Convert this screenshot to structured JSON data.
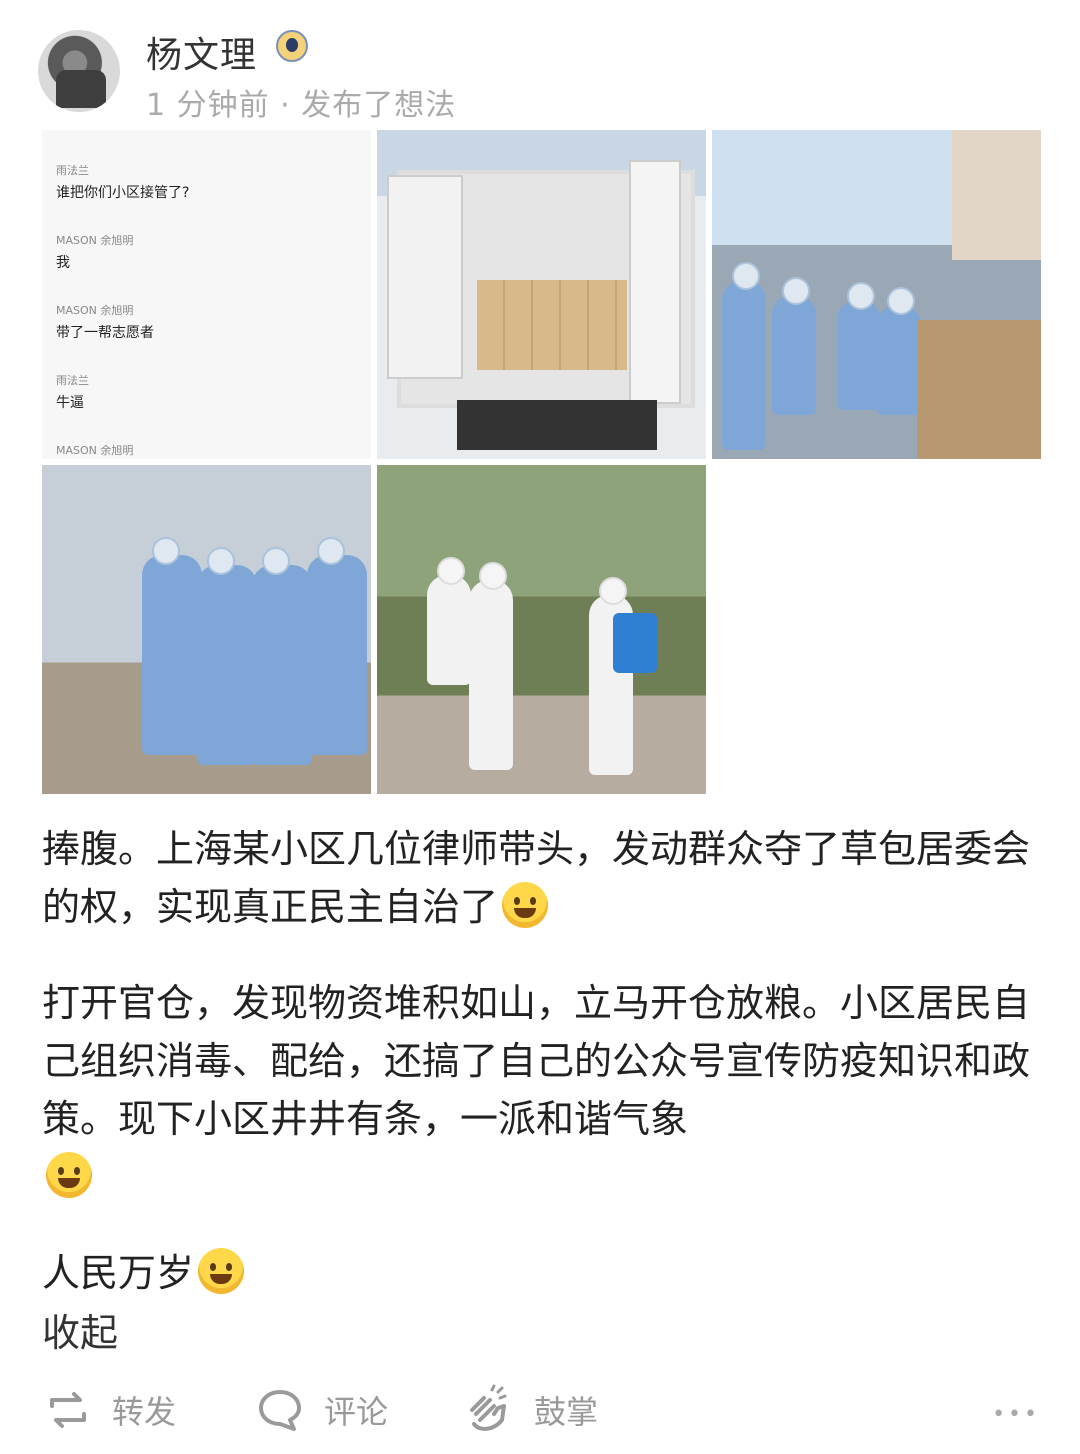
{
  "post": {
    "author": "杨文理",
    "meta": "1 分钟前 · 发布了想法"
  },
  "chat": [
    {
      "name": "雨法兰",
      "msg": "谁把你们小区接管了?"
    },
    {
      "name": "MASON 余旭明",
      "msg": "我"
    },
    {
      "name": "MASON 余旭明",
      "msg": "带了一帮志愿者"
    },
    {
      "name": "雨法兰",
      "msg": "牛逼"
    },
    {
      "name": "MASON 余旭明",
      "msg": ""
    }
  ],
  "body": {
    "p1": "捧腹。上海某小区几位律师带头，发动群众夺了草包居委会的权，实现真正民主自治了",
    "p2": "打开官仓，发现物资堆积如山，立马开仓放粮。小区居民自己组织消毒、配给，还搞了自己的公众号宣传防疫知识和政策。现下小区井井有条，一派和谐气象",
    "p3": "人民万岁",
    "collapse": "收起"
  },
  "actions": {
    "repost": "转发",
    "comment": "评论",
    "applaud": "鼓掌",
    "more": "•••"
  }
}
